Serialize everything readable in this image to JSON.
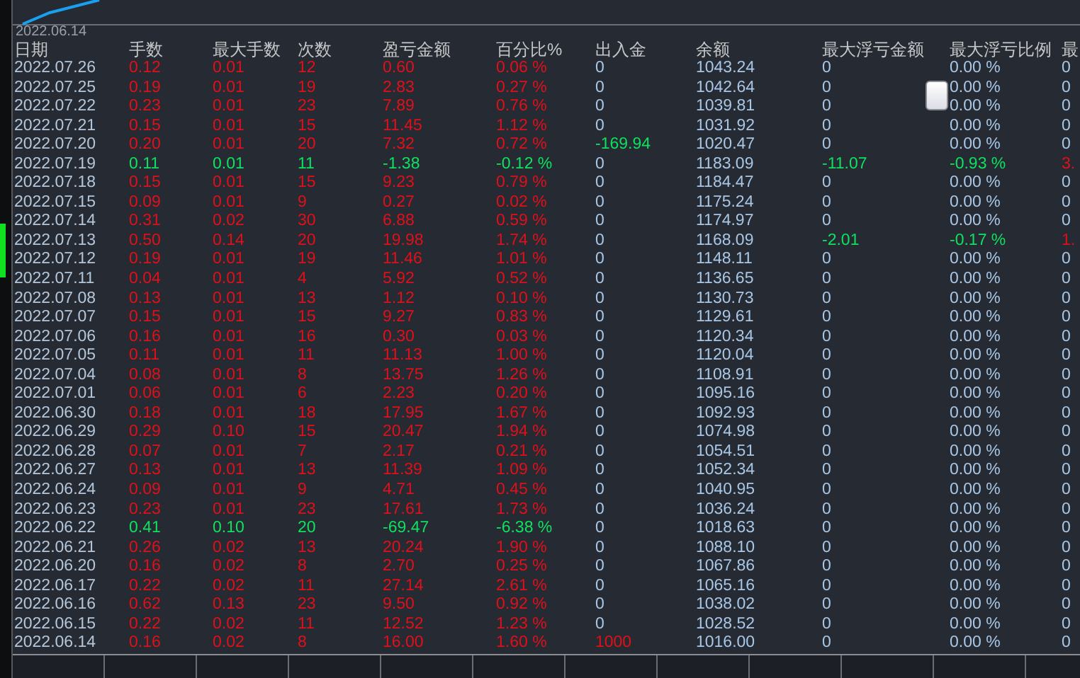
{
  "chart_strip": {
    "date_label": "2022.06.14"
  },
  "table": {
    "columns": [
      "日期",
      "手数",
      "最大手数",
      "次数",
      "盈亏金额",
      "百分比%",
      "出入金",
      "余额",
      "最大浮亏金额",
      "最大浮亏比例",
      "最"
    ],
    "rows": [
      {
        "cells": [
          {
            "text": "2022.07.26",
            "color": "#b4c6da"
          },
          {
            "text": "0.12",
            "color": "#e0101a"
          },
          {
            "text": "0.01",
            "color": "#e0101a"
          },
          {
            "text": "12",
            "color": "#e0101a"
          },
          {
            "text": "0.60",
            "color": "#e0101a"
          },
          {
            "text": "0.06 %",
            "color": "#e0101a"
          },
          {
            "text": "0",
            "color": "#a8c6e6"
          },
          {
            "text": "1043.24",
            "color": "#a8c6e6"
          },
          {
            "text": "0",
            "color": "#a8c6e6"
          },
          {
            "text": "0.00 %",
            "color": "#a8c6e6"
          },
          {
            "text": "0",
            "color": "#a8c6e6"
          }
        ]
      },
      {
        "cells": [
          {
            "text": "2022.07.25",
            "color": "#b4c6da"
          },
          {
            "text": "0.19",
            "color": "#e0101a"
          },
          {
            "text": "0.01",
            "color": "#e0101a"
          },
          {
            "text": "19",
            "color": "#e0101a"
          },
          {
            "text": "2.83",
            "color": "#e0101a"
          },
          {
            "text": "0.27 %",
            "color": "#e0101a"
          },
          {
            "text": "0",
            "color": "#a8c6e6"
          },
          {
            "text": "1042.64",
            "color": "#a8c6e6"
          },
          {
            "text": "0",
            "color": "#a8c6e6"
          },
          {
            "text": "0.00 %",
            "color": "#a8c6e6"
          },
          {
            "text": "0",
            "color": "#a8c6e6"
          }
        ]
      },
      {
        "cells": [
          {
            "text": "2022.07.22",
            "color": "#b4c6da"
          },
          {
            "text": "0.23",
            "color": "#e0101a"
          },
          {
            "text": "0.01",
            "color": "#e0101a"
          },
          {
            "text": "23",
            "color": "#e0101a"
          },
          {
            "text": "7.89",
            "color": "#e0101a"
          },
          {
            "text": "0.76 %",
            "color": "#e0101a"
          },
          {
            "text": "0",
            "color": "#a8c6e6"
          },
          {
            "text": "1039.81",
            "color": "#a8c6e6"
          },
          {
            "text": "0",
            "color": "#a8c6e6"
          },
          {
            "text": "0.00 %",
            "color": "#a8c6e6"
          },
          {
            "text": "0",
            "color": "#a8c6e6"
          }
        ]
      },
      {
        "cells": [
          {
            "text": "2022.07.21",
            "color": "#b4c6da"
          },
          {
            "text": "0.15",
            "color": "#e0101a"
          },
          {
            "text": "0.01",
            "color": "#e0101a"
          },
          {
            "text": "15",
            "color": "#e0101a"
          },
          {
            "text": "11.45",
            "color": "#e0101a"
          },
          {
            "text": "1.12 %",
            "color": "#e0101a"
          },
          {
            "text": "0",
            "color": "#a8c6e6"
          },
          {
            "text": "1031.92",
            "color": "#a8c6e6"
          },
          {
            "text": "0",
            "color": "#a8c6e6"
          },
          {
            "text": "0.00 %",
            "color": "#a8c6e6"
          },
          {
            "text": "0",
            "color": "#a8c6e6"
          }
        ]
      },
      {
        "cells": [
          {
            "text": "2022.07.20",
            "color": "#b4c6da"
          },
          {
            "text": "0.20",
            "color": "#e0101a"
          },
          {
            "text": "0.01",
            "color": "#e0101a"
          },
          {
            "text": "20",
            "color": "#e0101a"
          },
          {
            "text": "7.32",
            "color": "#e0101a"
          },
          {
            "text": "0.72 %",
            "color": "#e0101a"
          },
          {
            "text": "-169.94",
            "color": "#10e060"
          },
          {
            "text": "1020.47",
            "color": "#a8c6e6"
          },
          {
            "text": "0",
            "color": "#a8c6e6"
          },
          {
            "text": "0.00 %",
            "color": "#a8c6e6"
          },
          {
            "text": "0",
            "color": "#a8c6e6"
          }
        ]
      },
      {
        "cells": [
          {
            "text": "2022.07.19",
            "color": "#b4c6da"
          },
          {
            "text": "0.11",
            "color": "#10e060"
          },
          {
            "text": "0.01",
            "color": "#10e060"
          },
          {
            "text": "11",
            "color": "#10e060"
          },
          {
            "text": "-1.38",
            "color": "#10e060"
          },
          {
            "text": "-0.12 %",
            "color": "#10e060"
          },
          {
            "text": "0",
            "color": "#a8c6e6"
          },
          {
            "text": "1183.09",
            "color": "#a8c6e6"
          },
          {
            "text": "-11.07",
            "color": "#10e060"
          },
          {
            "text": "-0.93 %",
            "color": "#10e060"
          },
          {
            "text": "3.",
            "color": "#e0101a"
          }
        ]
      },
      {
        "cells": [
          {
            "text": "2022.07.18",
            "color": "#b4c6da"
          },
          {
            "text": "0.15",
            "color": "#e0101a"
          },
          {
            "text": "0.01",
            "color": "#e0101a"
          },
          {
            "text": "15",
            "color": "#e0101a"
          },
          {
            "text": "9.23",
            "color": "#e0101a"
          },
          {
            "text": "0.79 %",
            "color": "#e0101a"
          },
          {
            "text": "0",
            "color": "#a8c6e6"
          },
          {
            "text": "1184.47",
            "color": "#a8c6e6"
          },
          {
            "text": "0",
            "color": "#a8c6e6"
          },
          {
            "text": "0.00 %",
            "color": "#a8c6e6"
          },
          {
            "text": "0",
            "color": "#a8c6e6"
          }
        ]
      },
      {
        "cells": [
          {
            "text": "2022.07.15",
            "color": "#b4c6da"
          },
          {
            "text": "0.09",
            "color": "#e0101a"
          },
          {
            "text": "0.01",
            "color": "#e0101a"
          },
          {
            "text": "9",
            "color": "#e0101a"
          },
          {
            "text": "0.27",
            "color": "#e0101a"
          },
          {
            "text": "0.02 %",
            "color": "#e0101a"
          },
          {
            "text": "0",
            "color": "#a8c6e6"
          },
          {
            "text": "1175.24",
            "color": "#a8c6e6"
          },
          {
            "text": "0",
            "color": "#a8c6e6"
          },
          {
            "text": "0.00 %",
            "color": "#a8c6e6"
          },
          {
            "text": "0",
            "color": "#a8c6e6"
          }
        ]
      },
      {
        "cells": [
          {
            "text": "2022.07.14",
            "color": "#b4c6da"
          },
          {
            "text": "0.31",
            "color": "#e0101a"
          },
          {
            "text": "0.02",
            "color": "#e0101a"
          },
          {
            "text": "30",
            "color": "#e0101a"
          },
          {
            "text": "6.88",
            "color": "#e0101a"
          },
          {
            "text": "0.59 %",
            "color": "#e0101a"
          },
          {
            "text": "0",
            "color": "#a8c6e6"
          },
          {
            "text": "1174.97",
            "color": "#a8c6e6"
          },
          {
            "text": "0",
            "color": "#a8c6e6"
          },
          {
            "text": "0.00 %",
            "color": "#a8c6e6"
          },
          {
            "text": "0",
            "color": "#a8c6e6"
          }
        ]
      },
      {
        "cells": [
          {
            "text": "2022.07.13",
            "color": "#b4c6da"
          },
          {
            "text": "0.50",
            "color": "#e0101a"
          },
          {
            "text": "0.14",
            "color": "#e0101a"
          },
          {
            "text": "20",
            "color": "#e0101a"
          },
          {
            "text": "19.98",
            "color": "#e0101a"
          },
          {
            "text": "1.74 %",
            "color": "#e0101a"
          },
          {
            "text": "0",
            "color": "#a8c6e6"
          },
          {
            "text": "1168.09",
            "color": "#a8c6e6"
          },
          {
            "text": "-2.01",
            "color": "#10e060"
          },
          {
            "text": "-0.17 %",
            "color": "#10e060"
          },
          {
            "text": "1.",
            "color": "#e0101a"
          }
        ]
      },
      {
        "cells": [
          {
            "text": "2022.07.12",
            "color": "#b4c6da"
          },
          {
            "text": "0.19",
            "color": "#e0101a"
          },
          {
            "text": "0.01",
            "color": "#e0101a"
          },
          {
            "text": "19",
            "color": "#e0101a"
          },
          {
            "text": "11.46",
            "color": "#e0101a"
          },
          {
            "text": "1.01 %",
            "color": "#e0101a"
          },
          {
            "text": "0",
            "color": "#a8c6e6"
          },
          {
            "text": "1148.11",
            "color": "#a8c6e6"
          },
          {
            "text": "0",
            "color": "#a8c6e6"
          },
          {
            "text": "0.00 %",
            "color": "#a8c6e6"
          },
          {
            "text": "0",
            "color": "#a8c6e6"
          }
        ]
      },
      {
        "cells": [
          {
            "text": "2022.07.11",
            "color": "#b4c6da"
          },
          {
            "text": "0.04",
            "color": "#e0101a"
          },
          {
            "text": "0.01",
            "color": "#e0101a"
          },
          {
            "text": "4",
            "color": "#e0101a"
          },
          {
            "text": "5.92",
            "color": "#e0101a"
          },
          {
            "text": "0.52 %",
            "color": "#e0101a"
          },
          {
            "text": "0",
            "color": "#a8c6e6"
          },
          {
            "text": "1136.65",
            "color": "#a8c6e6"
          },
          {
            "text": "0",
            "color": "#a8c6e6"
          },
          {
            "text": "0.00 %",
            "color": "#a8c6e6"
          },
          {
            "text": "0",
            "color": "#a8c6e6"
          }
        ]
      },
      {
        "cells": [
          {
            "text": "2022.07.08",
            "color": "#b4c6da"
          },
          {
            "text": "0.13",
            "color": "#e0101a"
          },
          {
            "text": "0.01",
            "color": "#e0101a"
          },
          {
            "text": "13",
            "color": "#e0101a"
          },
          {
            "text": "1.12",
            "color": "#e0101a"
          },
          {
            "text": "0.10 %",
            "color": "#e0101a"
          },
          {
            "text": "0",
            "color": "#a8c6e6"
          },
          {
            "text": "1130.73",
            "color": "#a8c6e6"
          },
          {
            "text": "0",
            "color": "#a8c6e6"
          },
          {
            "text": "0.00 %",
            "color": "#a8c6e6"
          },
          {
            "text": "0",
            "color": "#a8c6e6"
          }
        ]
      },
      {
        "cells": [
          {
            "text": "2022.07.07",
            "color": "#b4c6da"
          },
          {
            "text": "0.15",
            "color": "#e0101a"
          },
          {
            "text": "0.01",
            "color": "#e0101a"
          },
          {
            "text": "15",
            "color": "#e0101a"
          },
          {
            "text": "9.27",
            "color": "#e0101a"
          },
          {
            "text": "0.83 %",
            "color": "#e0101a"
          },
          {
            "text": "0",
            "color": "#a8c6e6"
          },
          {
            "text": "1129.61",
            "color": "#a8c6e6"
          },
          {
            "text": "0",
            "color": "#a8c6e6"
          },
          {
            "text": "0.00 %",
            "color": "#a8c6e6"
          },
          {
            "text": "0",
            "color": "#a8c6e6"
          }
        ]
      },
      {
        "cells": [
          {
            "text": "2022.07.06",
            "color": "#b4c6da"
          },
          {
            "text": "0.16",
            "color": "#e0101a"
          },
          {
            "text": "0.01",
            "color": "#e0101a"
          },
          {
            "text": "16",
            "color": "#e0101a"
          },
          {
            "text": "0.30",
            "color": "#e0101a"
          },
          {
            "text": "0.03 %",
            "color": "#e0101a"
          },
          {
            "text": "0",
            "color": "#a8c6e6"
          },
          {
            "text": "1120.34",
            "color": "#a8c6e6"
          },
          {
            "text": "0",
            "color": "#a8c6e6"
          },
          {
            "text": "0.00 %",
            "color": "#a8c6e6"
          },
          {
            "text": "0",
            "color": "#a8c6e6"
          }
        ]
      },
      {
        "cells": [
          {
            "text": "2022.07.05",
            "color": "#b4c6da"
          },
          {
            "text": "0.11",
            "color": "#e0101a"
          },
          {
            "text": "0.01",
            "color": "#e0101a"
          },
          {
            "text": "11",
            "color": "#e0101a"
          },
          {
            "text": "11.13",
            "color": "#e0101a"
          },
          {
            "text": "1.00 %",
            "color": "#e0101a"
          },
          {
            "text": "0",
            "color": "#a8c6e6"
          },
          {
            "text": "1120.04",
            "color": "#a8c6e6"
          },
          {
            "text": "0",
            "color": "#a8c6e6"
          },
          {
            "text": "0.00 %",
            "color": "#a8c6e6"
          },
          {
            "text": "0",
            "color": "#a8c6e6"
          }
        ]
      },
      {
        "cells": [
          {
            "text": "2022.07.04",
            "color": "#b4c6da"
          },
          {
            "text": "0.08",
            "color": "#e0101a"
          },
          {
            "text": "0.01",
            "color": "#e0101a"
          },
          {
            "text": "8",
            "color": "#e0101a"
          },
          {
            "text": "13.75",
            "color": "#e0101a"
          },
          {
            "text": "1.26 %",
            "color": "#e0101a"
          },
          {
            "text": "0",
            "color": "#a8c6e6"
          },
          {
            "text": "1108.91",
            "color": "#a8c6e6"
          },
          {
            "text": "0",
            "color": "#a8c6e6"
          },
          {
            "text": "0.00 %",
            "color": "#a8c6e6"
          },
          {
            "text": "0",
            "color": "#a8c6e6"
          }
        ]
      },
      {
        "cells": [
          {
            "text": "2022.07.01",
            "color": "#b4c6da"
          },
          {
            "text": "0.06",
            "color": "#e0101a"
          },
          {
            "text": "0.01",
            "color": "#e0101a"
          },
          {
            "text": "6",
            "color": "#e0101a"
          },
          {
            "text": "2.23",
            "color": "#e0101a"
          },
          {
            "text": "0.20 %",
            "color": "#e0101a"
          },
          {
            "text": "0",
            "color": "#a8c6e6"
          },
          {
            "text": "1095.16",
            "color": "#a8c6e6"
          },
          {
            "text": "0",
            "color": "#a8c6e6"
          },
          {
            "text": "0.00 %",
            "color": "#a8c6e6"
          },
          {
            "text": "0",
            "color": "#a8c6e6"
          }
        ]
      },
      {
        "cells": [
          {
            "text": "2022.06.30",
            "color": "#b4c6da"
          },
          {
            "text": "0.18",
            "color": "#e0101a"
          },
          {
            "text": "0.01",
            "color": "#e0101a"
          },
          {
            "text": "18",
            "color": "#e0101a"
          },
          {
            "text": "17.95",
            "color": "#e0101a"
          },
          {
            "text": "1.67 %",
            "color": "#e0101a"
          },
          {
            "text": "0",
            "color": "#a8c6e6"
          },
          {
            "text": "1092.93",
            "color": "#a8c6e6"
          },
          {
            "text": "0",
            "color": "#a8c6e6"
          },
          {
            "text": "0.00 %",
            "color": "#a8c6e6"
          },
          {
            "text": "0",
            "color": "#a8c6e6"
          }
        ]
      },
      {
        "cells": [
          {
            "text": "2022.06.29",
            "color": "#b4c6da"
          },
          {
            "text": "0.29",
            "color": "#e0101a"
          },
          {
            "text": "0.10",
            "color": "#e0101a"
          },
          {
            "text": "15",
            "color": "#e0101a"
          },
          {
            "text": "20.47",
            "color": "#e0101a"
          },
          {
            "text": "1.94 %",
            "color": "#e0101a"
          },
          {
            "text": "0",
            "color": "#a8c6e6"
          },
          {
            "text": "1074.98",
            "color": "#a8c6e6"
          },
          {
            "text": "0",
            "color": "#a8c6e6"
          },
          {
            "text": "0.00 %",
            "color": "#a8c6e6"
          },
          {
            "text": "0",
            "color": "#a8c6e6"
          }
        ]
      },
      {
        "cells": [
          {
            "text": "2022.06.28",
            "color": "#b4c6da"
          },
          {
            "text": "0.07",
            "color": "#e0101a"
          },
          {
            "text": "0.01",
            "color": "#e0101a"
          },
          {
            "text": "7",
            "color": "#e0101a"
          },
          {
            "text": "2.17",
            "color": "#e0101a"
          },
          {
            "text": "0.21 %",
            "color": "#e0101a"
          },
          {
            "text": "0",
            "color": "#a8c6e6"
          },
          {
            "text": "1054.51",
            "color": "#a8c6e6"
          },
          {
            "text": "0",
            "color": "#a8c6e6"
          },
          {
            "text": "0.00 %",
            "color": "#a8c6e6"
          },
          {
            "text": "0",
            "color": "#a8c6e6"
          }
        ]
      },
      {
        "cells": [
          {
            "text": "2022.06.27",
            "color": "#b4c6da"
          },
          {
            "text": "0.13",
            "color": "#e0101a"
          },
          {
            "text": "0.01",
            "color": "#e0101a"
          },
          {
            "text": "13",
            "color": "#e0101a"
          },
          {
            "text": "11.39",
            "color": "#e0101a"
          },
          {
            "text": "1.09 %",
            "color": "#e0101a"
          },
          {
            "text": "0",
            "color": "#a8c6e6"
          },
          {
            "text": "1052.34",
            "color": "#a8c6e6"
          },
          {
            "text": "0",
            "color": "#a8c6e6"
          },
          {
            "text": "0.00 %",
            "color": "#a8c6e6"
          },
          {
            "text": "0",
            "color": "#a8c6e6"
          }
        ]
      },
      {
        "cells": [
          {
            "text": "2022.06.24",
            "color": "#b4c6da"
          },
          {
            "text": "0.09",
            "color": "#e0101a"
          },
          {
            "text": "0.01",
            "color": "#e0101a"
          },
          {
            "text": "9",
            "color": "#e0101a"
          },
          {
            "text": "4.71",
            "color": "#e0101a"
          },
          {
            "text": "0.45 %",
            "color": "#e0101a"
          },
          {
            "text": "0",
            "color": "#a8c6e6"
          },
          {
            "text": "1040.95",
            "color": "#a8c6e6"
          },
          {
            "text": "0",
            "color": "#a8c6e6"
          },
          {
            "text": "0.00 %",
            "color": "#a8c6e6"
          },
          {
            "text": "0",
            "color": "#a8c6e6"
          }
        ]
      },
      {
        "cells": [
          {
            "text": "2022.06.23",
            "color": "#b4c6da"
          },
          {
            "text": "0.23",
            "color": "#e0101a"
          },
          {
            "text": "0.01",
            "color": "#e0101a"
          },
          {
            "text": "23",
            "color": "#e0101a"
          },
          {
            "text": "17.61",
            "color": "#e0101a"
          },
          {
            "text": "1.73 %",
            "color": "#e0101a"
          },
          {
            "text": "0",
            "color": "#a8c6e6"
          },
          {
            "text": "1036.24",
            "color": "#a8c6e6"
          },
          {
            "text": "0",
            "color": "#a8c6e6"
          },
          {
            "text": "0.00 %",
            "color": "#a8c6e6"
          },
          {
            "text": "0",
            "color": "#a8c6e6"
          }
        ]
      },
      {
        "cells": [
          {
            "text": "2022.06.22",
            "color": "#b4c6da"
          },
          {
            "text": "0.41",
            "color": "#10e060"
          },
          {
            "text": "0.10",
            "color": "#10e060"
          },
          {
            "text": "20",
            "color": "#10e060"
          },
          {
            "text": "-69.47",
            "color": "#10e060"
          },
          {
            "text": "-6.38 %",
            "color": "#10e060"
          },
          {
            "text": "0",
            "color": "#a8c6e6"
          },
          {
            "text": "1018.63",
            "color": "#a8c6e6"
          },
          {
            "text": "0",
            "color": "#a8c6e6"
          },
          {
            "text": "0.00 %",
            "color": "#a8c6e6"
          },
          {
            "text": "0",
            "color": "#a8c6e6"
          }
        ]
      },
      {
        "cells": [
          {
            "text": "2022.06.21",
            "color": "#b4c6da"
          },
          {
            "text": "0.26",
            "color": "#e0101a"
          },
          {
            "text": "0.02",
            "color": "#e0101a"
          },
          {
            "text": "13",
            "color": "#e0101a"
          },
          {
            "text": "20.24",
            "color": "#e0101a"
          },
          {
            "text": "1.90 %",
            "color": "#e0101a"
          },
          {
            "text": "0",
            "color": "#a8c6e6"
          },
          {
            "text": "1088.10",
            "color": "#a8c6e6"
          },
          {
            "text": "0",
            "color": "#a8c6e6"
          },
          {
            "text": "0.00 %",
            "color": "#a8c6e6"
          },
          {
            "text": "0",
            "color": "#a8c6e6"
          }
        ]
      },
      {
        "cells": [
          {
            "text": "2022.06.20",
            "color": "#b4c6da"
          },
          {
            "text": "0.16",
            "color": "#e0101a"
          },
          {
            "text": "0.02",
            "color": "#e0101a"
          },
          {
            "text": "8",
            "color": "#e0101a"
          },
          {
            "text": "2.70",
            "color": "#e0101a"
          },
          {
            "text": "0.25 %",
            "color": "#e0101a"
          },
          {
            "text": "0",
            "color": "#a8c6e6"
          },
          {
            "text": "1067.86",
            "color": "#a8c6e6"
          },
          {
            "text": "0",
            "color": "#a8c6e6"
          },
          {
            "text": "0.00 %",
            "color": "#a8c6e6"
          },
          {
            "text": "0",
            "color": "#a8c6e6"
          }
        ]
      },
      {
        "cells": [
          {
            "text": "2022.06.17",
            "color": "#b4c6da"
          },
          {
            "text": "0.22",
            "color": "#e0101a"
          },
          {
            "text": "0.02",
            "color": "#e0101a"
          },
          {
            "text": "11",
            "color": "#e0101a"
          },
          {
            "text": "27.14",
            "color": "#e0101a"
          },
          {
            "text": "2.61 %",
            "color": "#e0101a"
          },
          {
            "text": "0",
            "color": "#a8c6e6"
          },
          {
            "text": "1065.16",
            "color": "#a8c6e6"
          },
          {
            "text": "0",
            "color": "#a8c6e6"
          },
          {
            "text": "0.00 %",
            "color": "#a8c6e6"
          },
          {
            "text": "0",
            "color": "#a8c6e6"
          }
        ]
      },
      {
        "cells": [
          {
            "text": "2022.06.16",
            "color": "#b4c6da"
          },
          {
            "text": "0.62",
            "color": "#e0101a"
          },
          {
            "text": "0.13",
            "color": "#e0101a"
          },
          {
            "text": "23",
            "color": "#e0101a"
          },
          {
            "text": "9.50",
            "color": "#e0101a"
          },
          {
            "text": "0.92 %",
            "color": "#e0101a"
          },
          {
            "text": "0",
            "color": "#a8c6e6"
          },
          {
            "text": "1038.02",
            "color": "#a8c6e6"
          },
          {
            "text": "0",
            "color": "#a8c6e6"
          },
          {
            "text": "0.00 %",
            "color": "#a8c6e6"
          },
          {
            "text": "0",
            "color": "#a8c6e6"
          }
        ]
      },
      {
        "cells": [
          {
            "text": "2022.06.15",
            "color": "#b4c6da"
          },
          {
            "text": "0.22",
            "color": "#e0101a"
          },
          {
            "text": "0.02",
            "color": "#e0101a"
          },
          {
            "text": "11",
            "color": "#e0101a"
          },
          {
            "text": "12.52",
            "color": "#e0101a"
          },
          {
            "text": "1.23 %",
            "color": "#e0101a"
          },
          {
            "text": "0",
            "color": "#a8c6e6"
          },
          {
            "text": "1028.52",
            "color": "#a8c6e6"
          },
          {
            "text": "0",
            "color": "#a8c6e6"
          },
          {
            "text": "0.00 %",
            "color": "#a8c6e6"
          },
          {
            "text": "0",
            "color": "#a8c6e6"
          }
        ]
      },
      {
        "cells": [
          {
            "text": "2022.06.14",
            "color": "#b4c6da"
          },
          {
            "text": "0.16",
            "color": "#e0101a"
          },
          {
            "text": "0.02",
            "color": "#e0101a"
          },
          {
            "text": "8",
            "color": "#e0101a"
          },
          {
            "text": "16.00",
            "color": "#e0101a"
          },
          {
            "text": "1.60 %",
            "color": "#e0101a"
          },
          {
            "text": "1000",
            "color": "#e0101a"
          },
          {
            "text": "1016.00",
            "color": "#a8c6e6"
          },
          {
            "text": "0",
            "color": "#a8c6e6"
          },
          {
            "text": "0.00 %",
            "color": "#a8c6e6"
          },
          {
            "text": "0",
            "color": "#a8c6e6"
          }
        ]
      }
    ]
  }
}
